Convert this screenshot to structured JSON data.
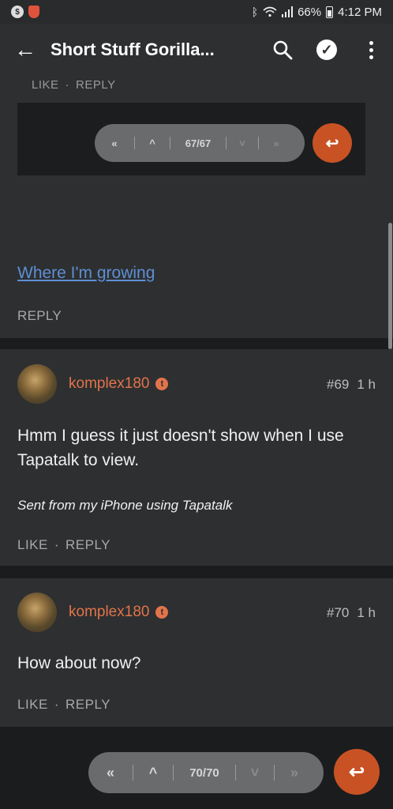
{
  "status_bar": {
    "battery": "66%",
    "time": "4:12 PM",
    "left_icons": [
      "dollar-icon",
      "shield-icon"
    ],
    "right_icons": [
      "bluetooth-icon",
      "wifi-icon",
      "signal-icon",
      "battery-icon"
    ]
  },
  "app_bar": {
    "title": "Short Stuff Gorilla...",
    "back_icon": "←",
    "search_icon": "⌕",
    "check_icon": "✓"
  },
  "previous_post": {
    "like_label": "LIKE",
    "reply_label": "REPLY",
    "separator": "·",
    "embedded_pager": {
      "count": "67/67",
      "first": "«",
      "prev": "^",
      "next": "˅",
      "last": "»",
      "reply_icon": "↩"
    },
    "link_text": "Where I'm growing",
    "reply_label_only": "REPLY"
  },
  "posts": [
    {
      "username": "komplex180",
      "badge": "t",
      "number": "#69",
      "time": "1 h",
      "body": "Hmm I guess it just doesn't show when I use Tapatalk to view.",
      "signature": "Sent from my iPhone using Tapatalk",
      "like_label": "LIKE",
      "reply_label": "REPLY",
      "separator": "·"
    },
    {
      "username": "komplex180",
      "badge": "t",
      "number": "#70",
      "time": "1 h",
      "body": "How about now?",
      "like_label": "LIKE",
      "reply_label": "REPLY",
      "separator": "·"
    }
  ],
  "bottom_pager": {
    "count": "70/70",
    "first": "«",
    "prev": "^",
    "next": "˅",
    "last": "»",
    "reply_icon": "↩"
  },
  "colors": {
    "accent": "#c85224",
    "username": "#e2744a",
    "link": "#5d8fd4",
    "card": "#2e2f31",
    "background": "#1b1c1e"
  }
}
